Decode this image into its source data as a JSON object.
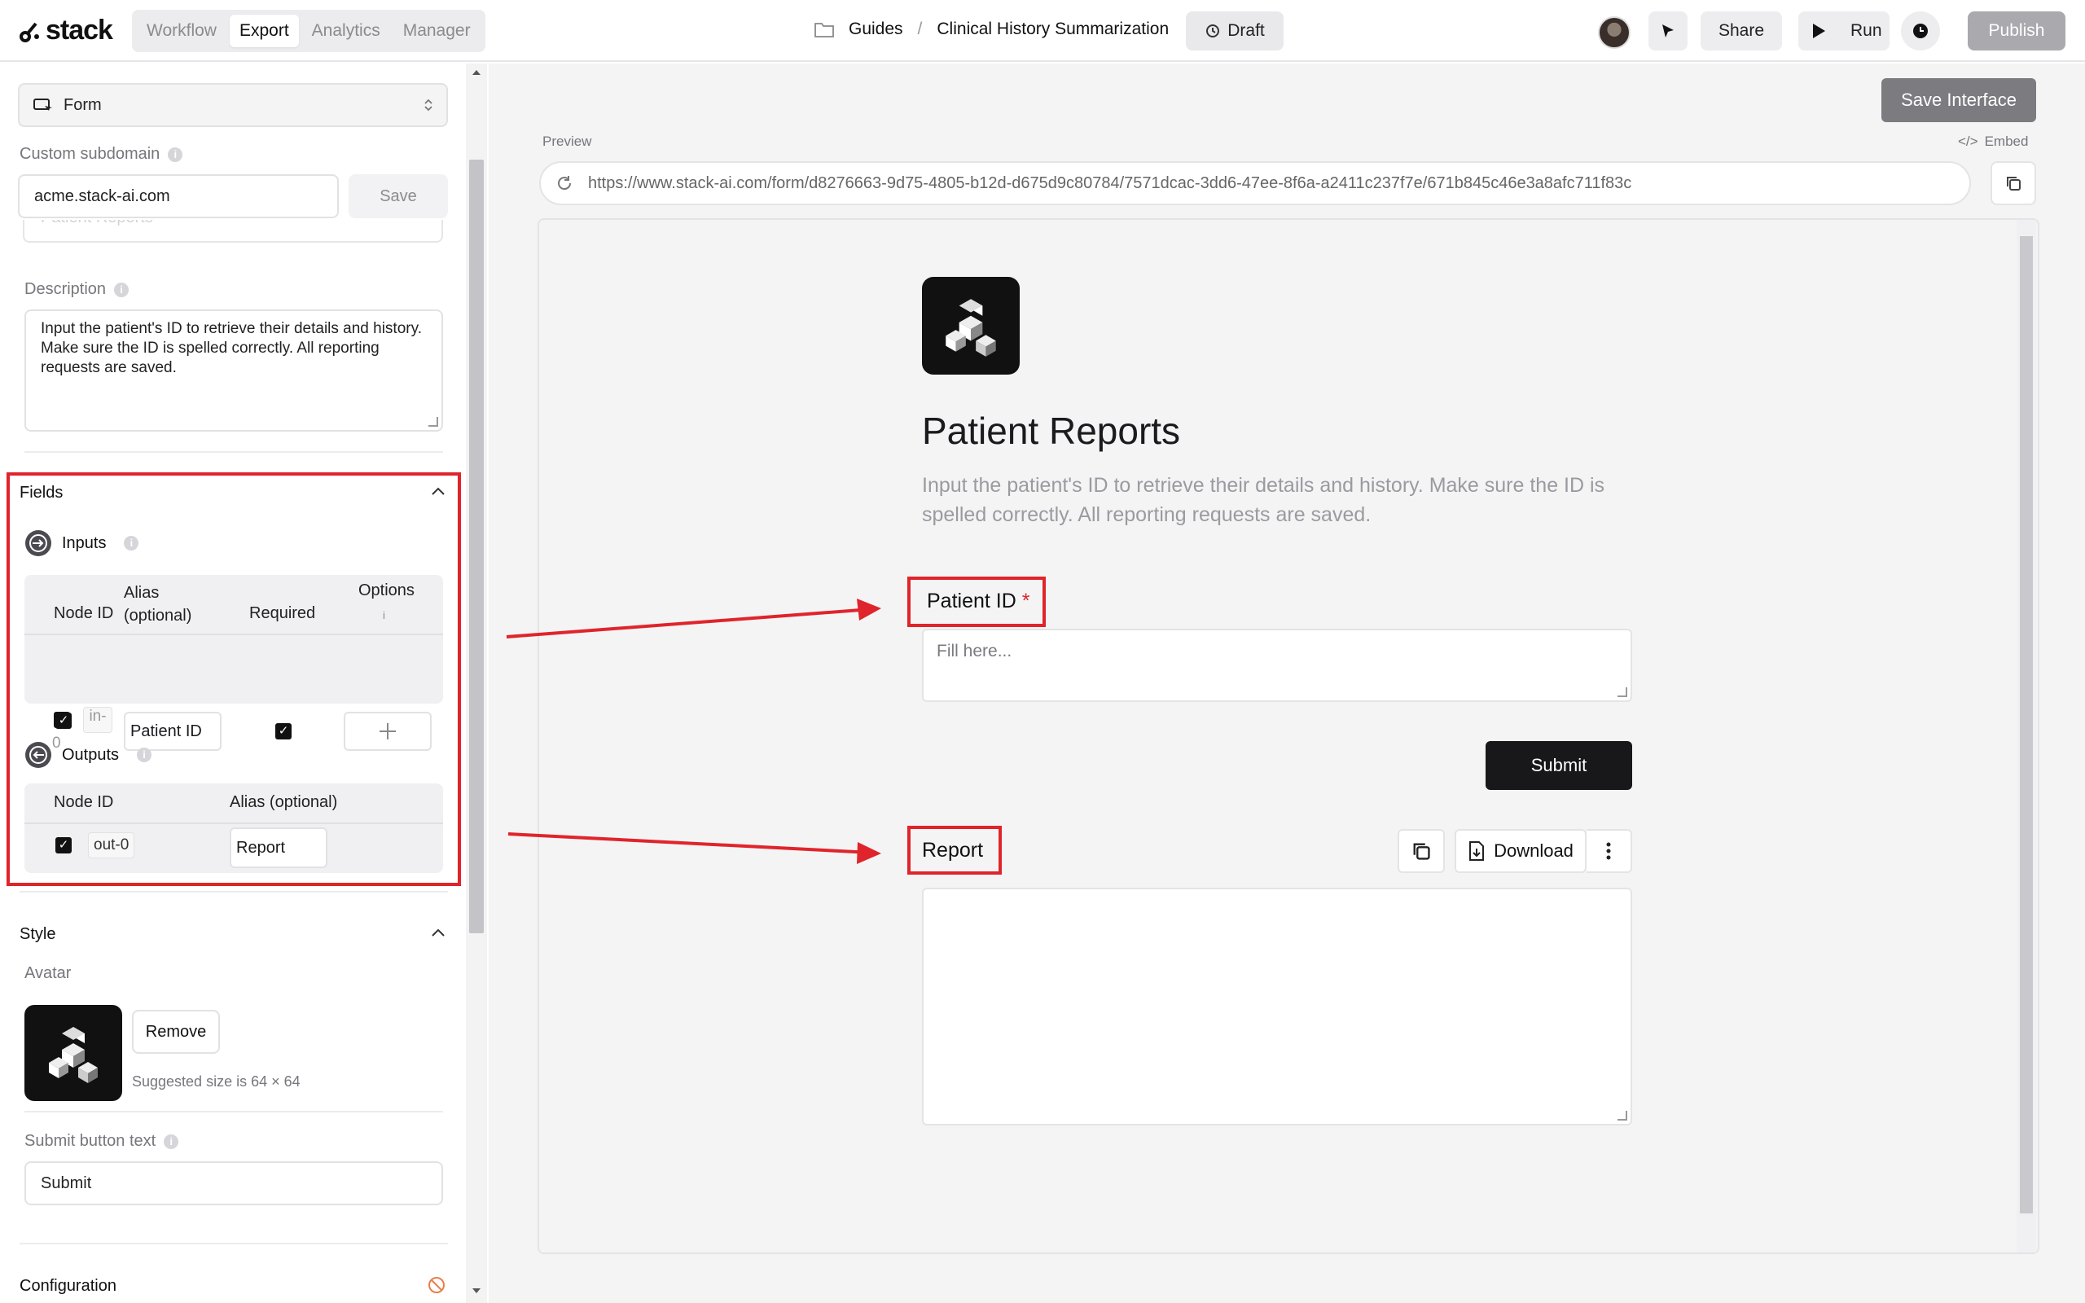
{
  "topbar": {
    "logo": "stack",
    "tabs": [
      {
        "label": "Workflow"
      },
      {
        "label": "Export"
      },
      {
        "label": "Analytics"
      },
      {
        "label": "Manager"
      }
    ],
    "breadcrumb": {
      "folder": "Guides",
      "separator": "/",
      "project": "Clinical History Summarization"
    },
    "draft_label": "Draft",
    "share_label": "Share",
    "run_label": "Run",
    "publish_label": "Publish"
  },
  "left": {
    "mode_select": "Form",
    "custom_subdomain": {
      "label": "Custom subdomain",
      "value": "acme.stack-ai.com",
      "save_label": "Save"
    },
    "title_field_partial": "Patient Reports",
    "description": {
      "label": "Description",
      "value": "Input the patient's ID to retrieve their details and history. Make sure the ID is spelled correctly. All reporting requests are saved."
    },
    "fields": {
      "title": "Fields",
      "inputs": {
        "title": "Inputs",
        "headers": {
          "node_id": "Node ID",
          "alias_line1": "Alias",
          "alias_line2": "(optional)",
          "required": "Required",
          "options": "Options",
          "options_info": "i"
        },
        "row": {
          "node_id_top": "in-",
          "node_id_bottom": "0",
          "alias": "Patient ID"
        }
      },
      "outputs": {
        "title": "Outputs",
        "headers": {
          "node_id": "Node ID",
          "alias": "Alias (optional)"
        },
        "row": {
          "node_id": "out-0",
          "alias": "Report"
        }
      }
    },
    "style": {
      "title": "Style",
      "avatar_label": "Avatar",
      "remove_label": "Remove",
      "suggested": "Suggested size is 64 × 64",
      "submit_text_label": "Submit button text",
      "submit_text_value": "Submit"
    },
    "configuration_label": "Configuration"
  },
  "main": {
    "save_interface": "Save Interface",
    "preview_label": "Preview",
    "embed_label": "Embed",
    "url": "https://www.stack-ai.com/form/d8276663-9d75-4805-b12d-d675d9c80784/7571dcac-3dd6-47ee-8f6a-a2411c237f7e/671b845c46e3a8afc711f83c",
    "form": {
      "title": "Patient Reports",
      "description": "Input the patient's ID to retrieve their details and history. Make sure the ID is spelled correctly. All reporting requests are saved.",
      "patient_id_label": "Patient ID",
      "required_mark": "*",
      "placeholder": "Fill here...",
      "submit_label": "Submit",
      "report_label": "Report",
      "download_label": "Download"
    }
  },
  "colors": {
    "annotation_red": "#e0242b",
    "primary_dark": "#18181b"
  }
}
